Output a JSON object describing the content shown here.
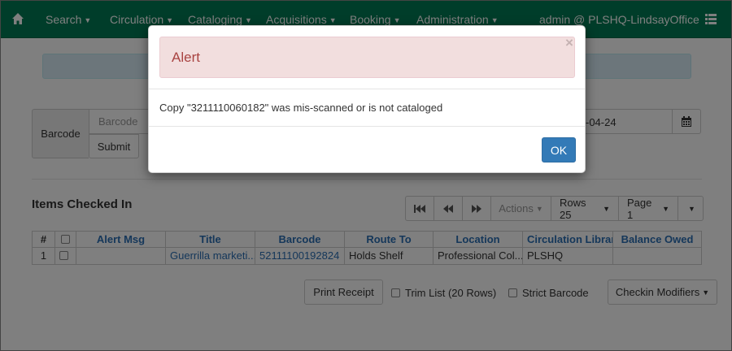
{
  "navbar": {
    "items": [
      {
        "label": "Search"
      },
      {
        "label": "Circulation"
      },
      {
        "label": "Cataloging"
      },
      {
        "label": "Acquisitions"
      },
      {
        "label": "Booking"
      },
      {
        "label": "Administration"
      }
    ],
    "user": "admin @ PLSHQ-LindsayOffice",
    "color": "#007a54"
  },
  "checkin_form": {
    "barcode_label": "Barcode",
    "barcode_placeholder": "Barcode",
    "submit_label": "Submit",
    "date_value": "-04-24"
  },
  "items_section": {
    "title": "Items Checked In",
    "toolbar": {
      "actions_label": "Actions",
      "rows_label": "Rows 25",
      "page_label": "Page 1"
    },
    "columns": [
      "#",
      "",
      "Alert Msg",
      "Title",
      "Barcode",
      "Route To",
      "Location",
      "Circulation Library",
      "Balance Owed"
    ],
    "rows": [
      {
        "num": "1",
        "alert_msg": "",
        "title": "Guerrilla marketi...",
        "barcode": "52111100192824",
        "route_to": "Holds Shelf",
        "location": "Professional Col...",
        "circ_lib": "PLSHQ",
        "balance": ""
      }
    ]
  },
  "bottom": {
    "print_label": "Print Receipt",
    "trim_label": "Trim List (20 Rows)",
    "strict_label": "Strict Barcode",
    "modifiers_label": "Checkin Modifiers"
  },
  "modal": {
    "title": "Alert",
    "close_symbol": "×",
    "message": "Copy \"3211110060182\" was mis-scanned or is not cataloged",
    "ok_label": "OK",
    "ok_color": "#337ab7",
    "alert_color": "#f2dede"
  }
}
